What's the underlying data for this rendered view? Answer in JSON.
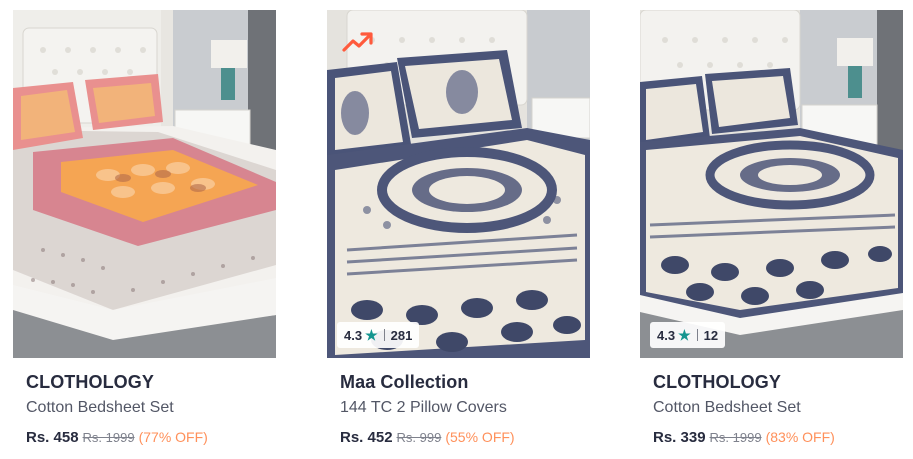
{
  "products": [
    {
      "brand": "CLOTHOLOGY",
      "name": "Cotton Bedsheet Set",
      "price": "Rs. 458",
      "mrp": "Rs. 1999",
      "discount": "(77% OFF)",
      "rating": null,
      "rating_count": null
    },
    {
      "brand": "Maa Collection",
      "name": "144 TC 2 Pillow Covers",
      "price": "Rs. 452",
      "mrp": "Rs. 999",
      "discount": "(55% OFF)",
      "rating": "4.3",
      "rating_count": "281",
      "icon": "trending-icon"
    },
    {
      "brand": "CLOTHOLOGY",
      "name": "Cotton Bedsheet Set",
      "price": "Rs. 339",
      "mrp": "Rs. 1999",
      "discount": "(83% OFF)",
      "rating": "4.3",
      "rating_count": "12"
    }
  ],
  "rating_star": "★",
  "colors": {
    "star": "#14958f",
    "discount": "#ff905a",
    "brand_text": "#282c3f",
    "trend_icon": "#ff5a3c"
  }
}
